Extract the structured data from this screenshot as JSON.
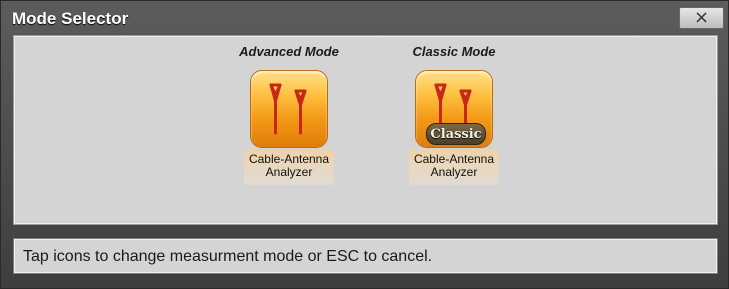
{
  "window": {
    "title": "Mode Selector",
    "close_label": "×"
  },
  "modes": [
    {
      "heading": "Advanced Mode",
      "icon": "antenna-icon",
      "label_line1": "Cable-Antenna",
      "label_line2": "Analyzer",
      "badge": ""
    },
    {
      "heading": "Classic Mode",
      "icon": "antenna-classic-icon",
      "label_line1": "Cable-Antenna",
      "label_line2": "Analyzer",
      "badge": "Classic"
    }
  ],
  "status": {
    "message": "Tap icons to change measurment mode or ESC to cancel."
  },
  "colors": {
    "icon_orange": "#f39a17",
    "antenna_red": "#c6281a",
    "titlebar": "#4a4a4a",
    "panel": "#d4d4d4"
  }
}
